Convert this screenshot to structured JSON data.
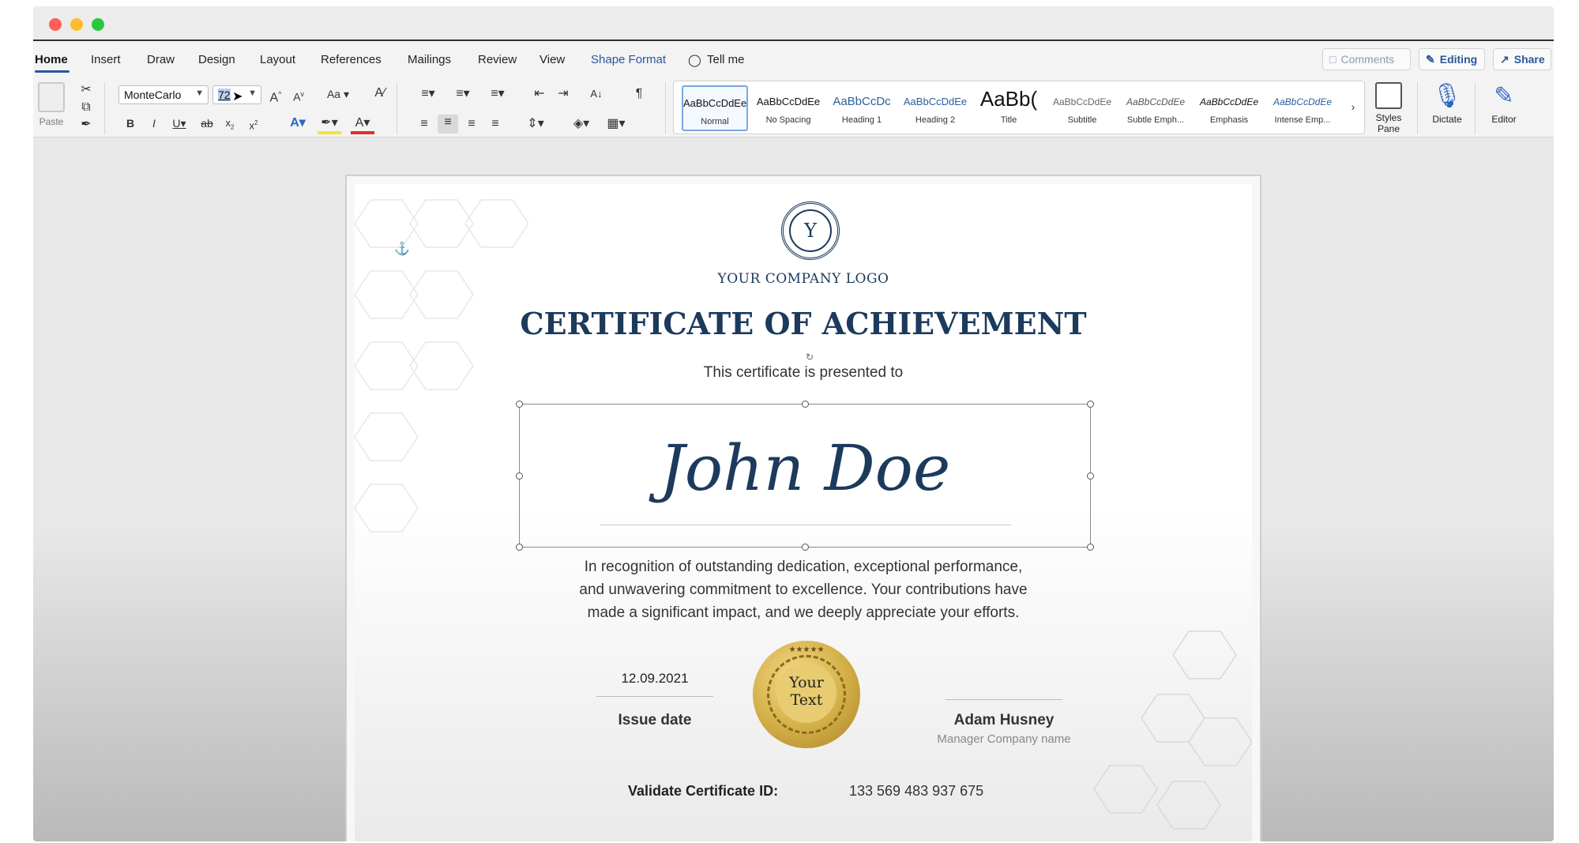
{
  "ribbon_tabs": [
    "Home",
    "Insert",
    "Draw",
    "Design",
    "Layout",
    "References",
    "Mailings",
    "Review",
    "View",
    "Shape Format"
  ],
  "tell_me": "Tell me",
  "comments_label": "Comments",
  "editing_label": "Editing",
  "share_label": "Share",
  "paste_label": "Paste",
  "font_name": "MonteCarlo",
  "font_size": "72",
  "case_label": "Aa",
  "styles": [
    {
      "preview": "AaBbCcDdEe",
      "name": "Normal"
    },
    {
      "preview": "AaBbCcDdEe",
      "name": "No Spacing"
    },
    {
      "preview": "AaBbCcDc",
      "name": "Heading 1"
    },
    {
      "preview": "AaBbCcDdEe",
      "name": "Heading 2"
    },
    {
      "preview": "AaBb(",
      "name": "Title"
    },
    {
      "preview": "AaBbCcDdEe",
      "name": "Subtitle"
    },
    {
      "preview": "AaBbCcDdEe",
      "name": "Subtle Emph..."
    },
    {
      "preview": "AaBbCcDdEe",
      "name": "Emphasis"
    },
    {
      "preview": "AaBbCcDdEe",
      "name": "Intense Emp..."
    }
  ],
  "styles_pane_label": "Styles Pane",
  "dictate_label": "Dictate",
  "editor_label": "Editor",
  "colors": {
    "accent_blue": "#2b579a",
    "navy_text": "#1c3a5c",
    "close": "#ff5f57",
    "minimize": "#febc2e",
    "maximize": "#28c840",
    "highlight_yellow": "#f3e33a",
    "font_color_red": "#e03030",
    "gold": "#d2ad45"
  },
  "certificate": {
    "logo_letter": "Y",
    "company_logo": "YOUR COMPANY LOGO",
    "title": "CERTIFICATE OF ACHIEVEMENT",
    "presented_to": "This certificate is presented to",
    "recipient": "John Doe",
    "body_lines": [
      "In recognition of outstanding dedication, exceptional performance,",
      "and unwavering commitment to excellence. Your contributions have",
      "made a significant impact, and we deeply appreciate your efforts."
    ],
    "date": "12.09.2021",
    "date_label": "Issue date",
    "seal_text_1": "Your",
    "seal_text_2": "Text",
    "signer_name": "Adam Husney",
    "signer_title": "Manager Company name",
    "validate_label": "Validate Certificate ID:",
    "certificate_id": "133 569 483 937 675"
  }
}
